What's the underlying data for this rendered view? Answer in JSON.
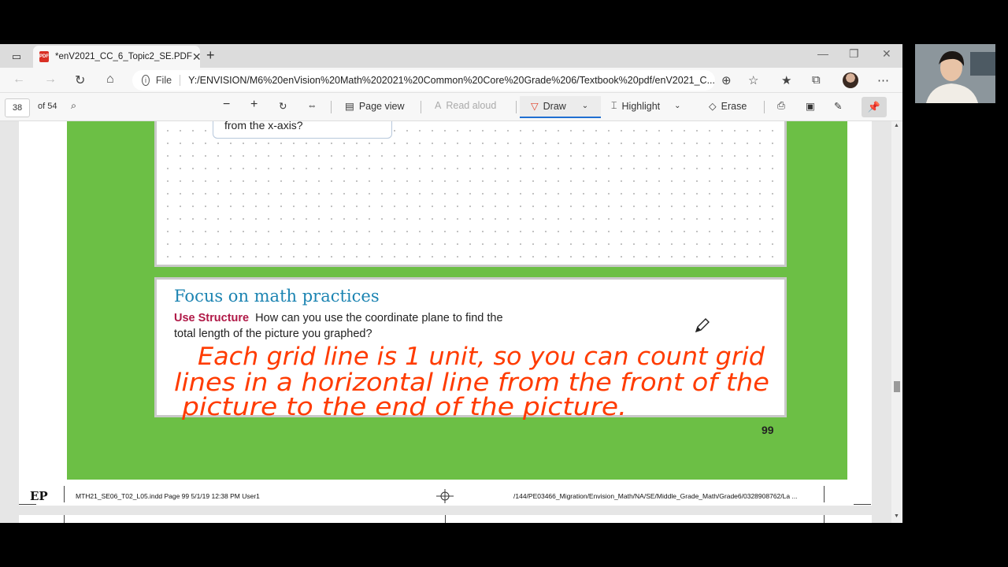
{
  "browser": {
    "tab_title": "*enV2021_CC_6_Topic2_SE.PDF",
    "pdf_badge": "PDF",
    "file_label": "File",
    "url": "Y:/ENVISION/M6%20enVision%20Math%202021%20Common%20Core%20Grade%206/Textbook%20pdf/enV2021_C..."
  },
  "pdf_toolbar": {
    "page_number": "38",
    "page_total": "of 54",
    "page_view": "Page view",
    "read_aloud": "Read aloud",
    "draw": "Draw",
    "highlight": "Highlight",
    "erase": "Erase"
  },
  "page": {
    "callout_text": "from the x-axis?",
    "focus_title": "Focus on math practices",
    "use_structure": "Use Structure",
    "question_line1": "How can you use the coordinate plane to find the",
    "question_line2": "total length of the picture you graphed?",
    "handwriting": {
      "line1": "Each grid line is 1 unit, so you can count grid",
      "line2": "lines in a horizontal line from the front of the",
      "line3": "picture to the end of the picture.",
      "color": "#ff3b00"
    },
    "page_number": "99",
    "slug_left": "MTH21_SE06_T02_L05.indd  Page 99  5/1/19  12:38 PM User1",
    "slug_right": "/144/PE03466_Migration/Envision_Math/NA/SE/Middle_Grade_Math/Grade6/0328908762/La ...",
    "ep_logo": "EP"
  },
  "colors": {
    "green_band": "#6cbf45",
    "title_blue": "#1c84b2",
    "structure_red": "#b01947",
    "draw_accent": "#1f6fd1"
  }
}
